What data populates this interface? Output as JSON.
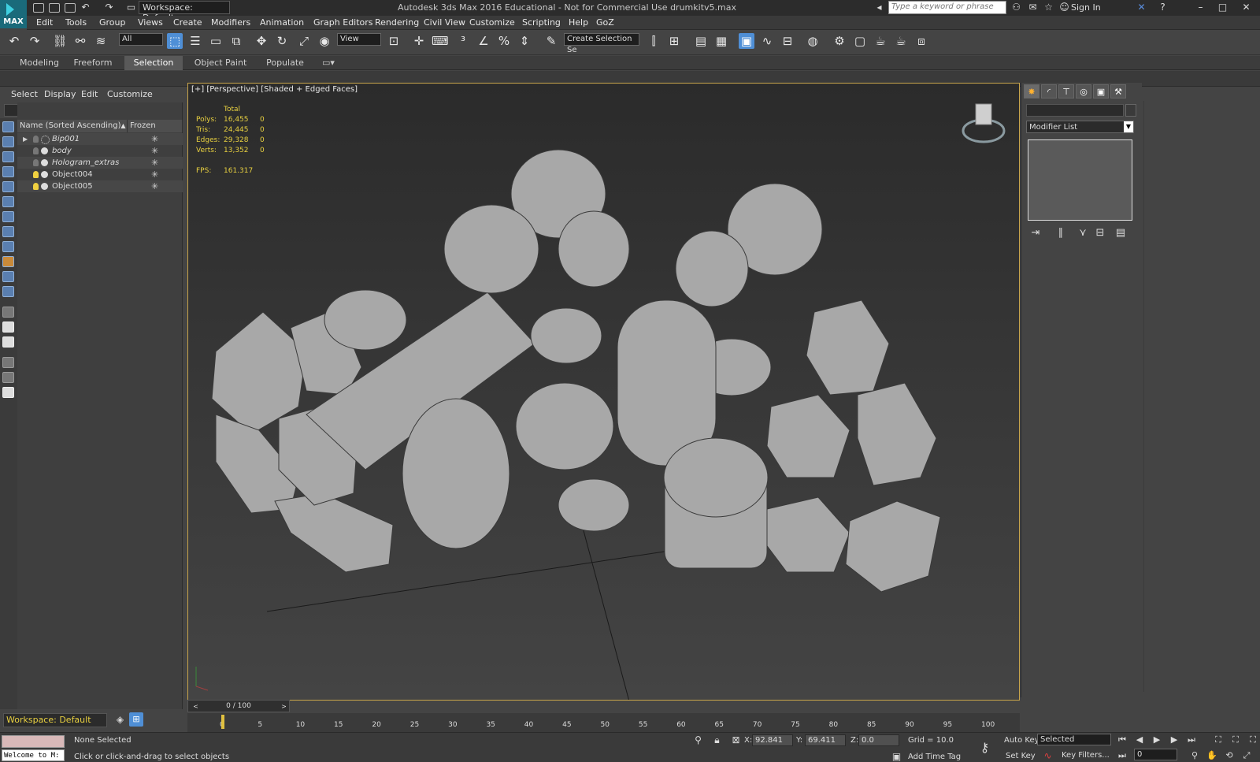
{
  "app": {
    "logo_text": "MAX",
    "workspace": "Workspace: Default",
    "title": "Autodesk 3ds Max 2016 Educational - Not for Commercial Use    drumkitv5.max",
    "search_placeholder": "Type a keyword or phrase",
    "sign_in": "Sign In"
  },
  "menu": [
    "Edit",
    "Tools",
    "Group",
    "Views",
    "Create",
    "Modifiers",
    "Animation",
    "Graph Editors",
    "Rendering",
    "Civil View",
    "Customize",
    "Scripting",
    "Help",
    "GoZ"
  ],
  "toolbar": {
    "filter_value": "All",
    "ref_coord_value": "View",
    "selection_set_value": "Create Selection Se"
  },
  "ribbon": {
    "tabs": [
      "Modeling",
      "Freeform",
      "Selection",
      "Object Paint",
      "Populate"
    ],
    "active": "Selection"
  },
  "scene_explorer": {
    "menus": [
      "Select",
      "Display",
      "Edit",
      "Customize"
    ],
    "col_name": "Name (Sorted Ascending)",
    "col_frozen": "Frozen",
    "rows": [
      {
        "name": "Bip001",
        "light": false,
        "italic": true
      },
      {
        "name": "body",
        "light": false,
        "italic": true
      },
      {
        "name": "Hologram_extras",
        "light": false,
        "italic": true
      },
      {
        "name": "Object004",
        "light": true,
        "italic": false
      },
      {
        "name": "Object005",
        "light": true,
        "italic": false
      }
    ],
    "workspace_bottom": "Workspace: Default"
  },
  "viewport": {
    "label": "[+] [Perspective] [Shaded + Edged Faces]",
    "stats": {
      "header": "Total",
      "polys_label": "Polys:",
      "polys_value": "16,455",
      "polys_sel": "0",
      "tris_label": "Tris:",
      "tris_value": "24,445",
      "tris_sel": "0",
      "edges_label": "Edges:",
      "edges_value": "29,328",
      "edges_sel": "0",
      "verts_label": "Verts:",
      "verts_value": "13,352",
      "verts_sel": "0",
      "fps_label": "FPS:",
      "fps_value": "161.317"
    }
  },
  "command_panel": {
    "modifier_list": "Modifier List"
  },
  "timeline": {
    "slider": "0 / 100",
    "ticks": [
      "0",
      "5",
      "10",
      "15",
      "20",
      "25",
      "30",
      "35",
      "40",
      "45",
      "50",
      "55",
      "60",
      "65",
      "70",
      "75",
      "80",
      "85",
      "90",
      "95",
      "100"
    ]
  },
  "status": {
    "maxscript_welcome": "Welcome to M:",
    "selection": "None Selected",
    "prompt": "Click or click-and-drag to select objects",
    "x_label": "X:",
    "x_value": "92.841",
    "y_label": "Y:",
    "y_value": "69.411",
    "z_label": "Z:",
    "z_value": "0.0",
    "grid": "Grid = 10.0",
    "add_time_tag": "Add Time Tag",
    "auto_key": "Auto Key",
    "set_key": "Set Key",
    "selected_value": "Selected",
    "key_filters": "Key Filters...",
    "frame_value": "0"
  }
}
